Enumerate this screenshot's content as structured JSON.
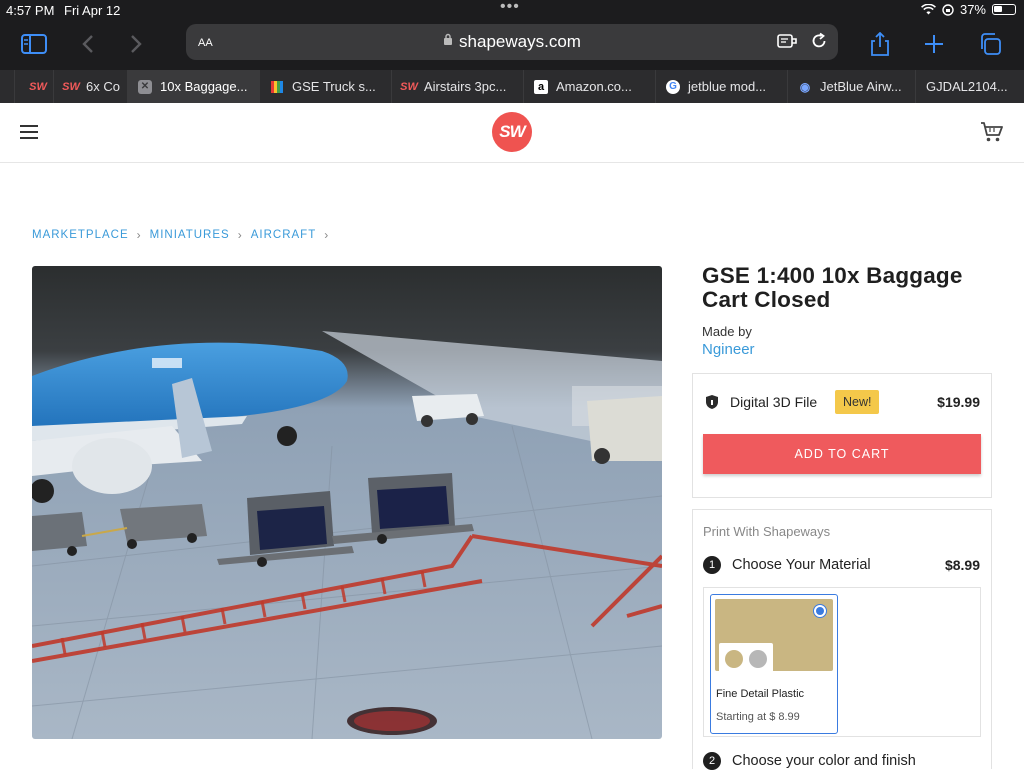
{
  "status": {
    "time": "4:57 PM",
    "date": "Fri Apr 12",
    "battery": "37%"
  },
  "browser": {
    "aa_label": "AA",
    "url": "shapeways.com",
    "tabs": [
      {
        "label": "",
        "icon": "shapeways-favicon"
      },
      {
        "label": "6x Co",
        "icon": "shapeways-favicon"
      },
      {
        "label": "10x Baggage...",
        "icon": "close-icon"
      },
      {
        "label": "GSE Truck s...",
        "icon": "multicolor-favicon"
      },
      {
        "label": "Airstairs 3pc...",
        "icon": "shapeways-favicon"
      },
      {
        "label": "Amazon.co...",
        "icon": "amazon-favicon"
      },
      {
        "label": "jetblue mod...",
        "icon": "google-favicon"
      },
      {
        "label": "JetBlue Airw...",
        "icon": "jetblue-favicon"
      },
      {
        "label": "GJDAL2104...",
        "icon": "none"
      }
    ]
  },
  "site": {
    "logo_text": "SW"
  },
  "breadcrumb": [
    "MARKETPLACE",
    "MINIATURES",
    "AIRCRAFT"
  ],
  "product": {
    "title": "GSE 1:400 10x Baggage Cart Closed",
    "made_by": "Made by",
    "designer": "Ngineer",
    "file_type": "Digital 3D File",
    "badge": "New!",
    "price": "$19.99",
    "add_to_cart": "ADD TO CART"
  },
  "print": {
    "header": "Print With Shapeways",
    "step1_num": "1",
    "step1_label": "Choose Your Material",
    "step1_price": "$8.99",
    "material_name": "Fine Detail Plastic",
    "material_price": "Starting at $ 8.99",
    "step2_num": "2",
    "step2_label": "Choose your color and finish"
  },
  "colors": {
    "accent": "#ef5a5d",
    "link": "#3a9ad9",
    "badge": "#f4c84a",
    "material": "#c9b682"
  }
}
